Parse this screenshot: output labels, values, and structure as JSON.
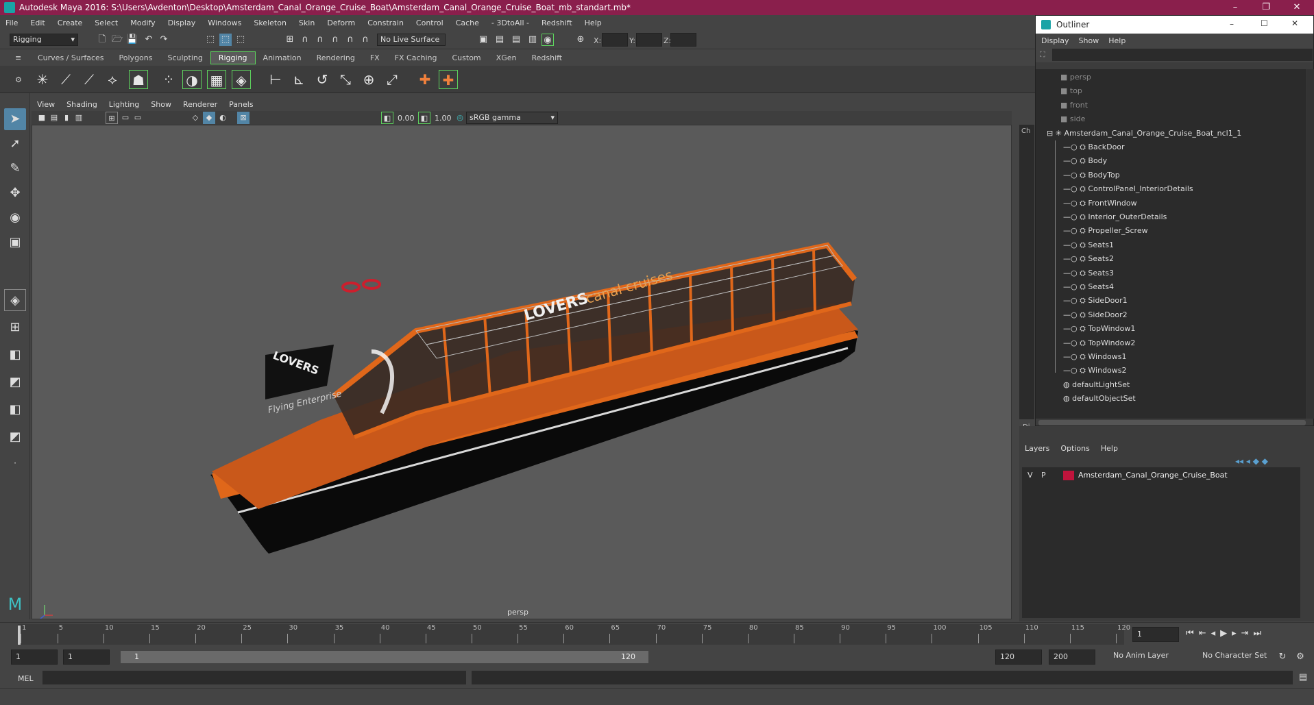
{
  "window": {
    "title": "Autodesk Maya 2016: S:\\Users\\Avdenton\\Desktop\\Amsterdam_Canal_Orange_Cruise_Boat\\Amsterdam_Canal_Orange_Cruise_Boat_mb_standart.mb*"
  },
  "menu": [
    "File",
    "Edit",
    "Create",
    "Select",
    "Modify",
    "Display",
    "Windows",
    "Skeleton",
    "Skin",
    "Deform",
    "Constrain",
    "Control",
    "Cache",
    "- 3DtoAll -",
    "Redshift",
    "Help"
  ],
  "status": {
    "mode": "Rigging",
    "live_surface": "No Live Surface",
    "x_label": "X:",
    "y_label": "Y:",
    "z_label": "Z:"
  },
  "shelf_tabs": [
    {
      "label": "Curves / Surfaces",
      "active": false
    },
    {
      "label": "Polygons",
      "active": false
    },
    {
      "label": "Sculpting",
      "active": false
    },
    {
      "label": "Rigging",
      "active": true
    },
    {
      "label": "Animation",
      "active": false
    },
    {
      "label": "Rendering",
      "active": false
    },
    {
      "label": "FX",
      "active": false
    },
    {
      "label": "FX Caching",
      "active": false
    },
    {
      "label": "Custom",
      "active": false
    },
    {
      "label": "XGen",
      "active": false
    },
    {
      "label": "Redshift",
      "active": false
    }
  ],
  "viewport": {
    "menu": [
      "View",
      "Shading",
      "Lighting",
      "Show",
      "Renderer",
      "Panels"
    ],
    "field1": "0.00",
    "field2": "1.00",
    "color_space": "sRGB gamma",
    "camera": "persp",
    "boat_text_1": "LOVERS",
    "boat_text_2": "canal cruises",
    "boat_text_3": "LOVERS",
    "boat_text_4": "Flying Enterprise"
  },
  "outliner": {
    "title": "Outliner",
    "menu": [
      "Display",
      "Show",
      "Help"
    ],
    "cameras": [
      "persp",
      "top",
      "front",
      "side"
    ],
    "root": "Amsterdam_Canal_Orange_Cruise_Boat_ncl1_1",
    "children": [
      "BackDoor",
      "Body",
      "BodyTop",
      "ControlPanel_InteriorDetails",
      "FrontWindow",
      "Interior_OuterDetails",
      "Propeller_Screw",
      "Seats1",
      "Seats2",
      "Seats3",
      "Seats4",
      "SideDoor1",
      "SideDoor2",
      "TopWindow1",
      "TopWindow2",
      "Windows1",
      "Windows2"
    ],
    "sets": [
      "defaultLightSet",
      "defaultObjectSet"
    ]
  },
  "side_tabs": {
    "channel": "Ch",
    "display": "Di"
  },
  "layers": {
    "menu": [
      "Layers",
      "Options",
      "Help"
    ],
    "v": "V",
    "p": "P",
    "layer_name": "Amsterdam_Canal_Orange_Cruise_Boat",
    "layer_color": "#c0143c"
  },
  "timeline": {
    "ticks": [
      "1",
      "5",
      "10",
      "15",
      "20",
      "25",
      "30",
      "35",
      "40",
      "45",
      "50",
      "55",
      "60",
      "65",
      "70",
      "75",
      "80",
      "85",
      "90",
      "95",
      "100",
      "105",
      "110",
      "115",
      "120"
    ],
    "current_frame": "1"
  },
  "range": {
    "start": "1",
    "start2": "1",
    "slider_start": "1",
    "slider_end": "120",
    "end": "120",
    "end2": "200",
    "anim_layer": "No Anim Layer",
    "char_set": "No Character Set"
  },
  "cmdline": {
    "label": "MEL"
  },
  "colors": {
    "title_bar": "#8a1f4c",
    "boat_orange": "#e0671a",
    "selection": "#5285a6",
    "active_tab_outline": "#5dd25d"
  }
}
